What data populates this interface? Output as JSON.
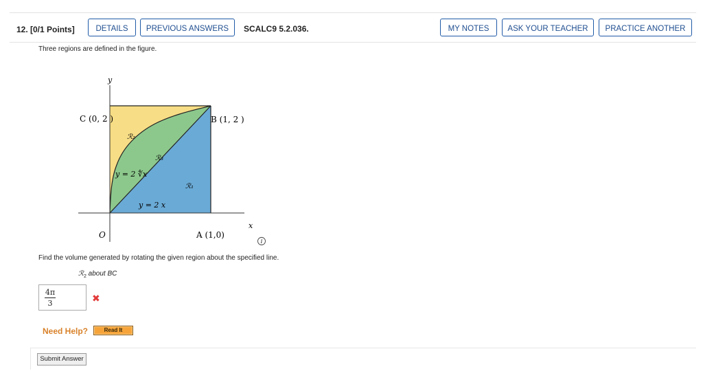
{
  "question": {
    "number_points": "12. [0/1 Points]",
    "code": "SCALC9 5.2.036."
  },
  "buttons": {
    "details": "DETAILS",
    "previous_answers": "PREVIOUS ANSWERS",
    "my_notes": "MY NOTES",
    "ask_teacher": "ASK YOUR TEACHER",
    "practice_another": "PRACTICE ANOTHER"
  },
  "content": {
    "intro": "Three regions are defined in the figure.",
    "instruction": "Find the volume generated by rotating the given region about the specified line.",
    "region_about": "about BC",
    "region_symbol": "ℛ",
    "region_sub": "2"
  },
  "figure": {
    "axis_y": "y",
    "axis_x": "x",
    "origin": "O",
    "point_c": "C (0, 2 )",
    "point_b": "B (1, 2 )",
    "point_a": "A (1,0)",
    "region_r1": "ℛ₁",
    "region_r2": "ℛ₂",
    "region_r3": "ℛ₃",
    "curve_label": "y = 2 ∜x",
    "line_label": "y = 2 x",
    "info_icon_glyph": "i",
    "colors": {
      "r1": "#6aaad6",
      "r2": "#f7dd85",
      "r3": "#8cc88c"
    }
  },
  "answer": {
    "numerator": "4π",
    "denominator": "3",
    "status_mark": "✖",
    "status": "incorrect"
  },
  "help": {
    "label": "Need Help?",
    "read_it": "Read It"
  },
  "submit": "Submit Answer",
  "colors": {
    "accent": "#1f5aa6",
    "error": "#e23a3a",
    "help": "#d9822b"
  }
}
